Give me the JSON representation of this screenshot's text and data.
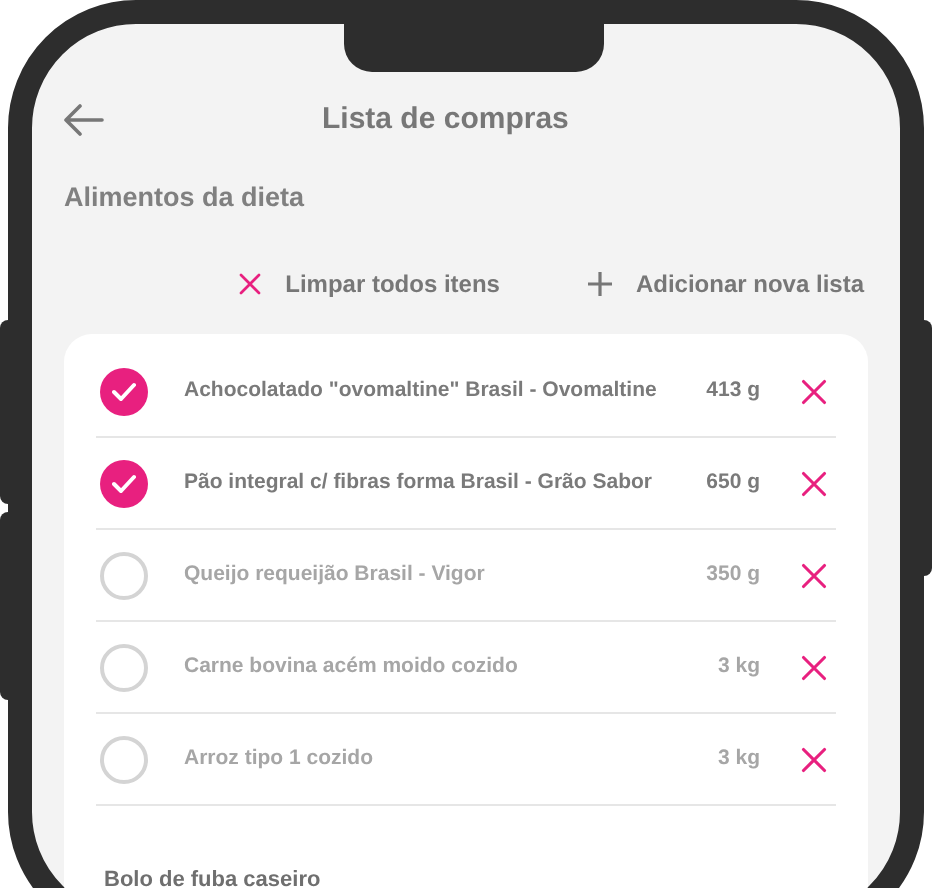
{
  "header": {
    "title": "Lista de compras"
  },
  "section_title": "Alimentos da dieta",
  "actions": [
    {
      "kind": "clear",
      "label": "Limpar todos itens"
    },
    {
      "kind": "add",
      "label": "Adicionar nova lista"
    }
  ],
  "items": [
    {
      "name": "Achocolatado \"ovomaltine\" Brasil - Ovomaltine",
      "quantity": "413 g",
      "checked": true
    },
    {
      "name": "Pão integral c/ fibras forma Brasil - Grão Sabor",
      "quantity": "650 g",
      "checked": true
    },
    {
      "name": "Queijo requeijão Brasil - Vigor",
      "quantity": "350 g",
      "checked": false
    },
    {
      "name": "Carne bovina acém moido cozido",
      "quantity": "3 kg",
      "checked": false
    },
    {
      "name": "Arroz tipo 1 cozido",
      "quantity": "3 kg",
      "checked": false
    }
  ],
  "recipe": {
    "title": "Bolo de fuba caseiro"
  }
}
